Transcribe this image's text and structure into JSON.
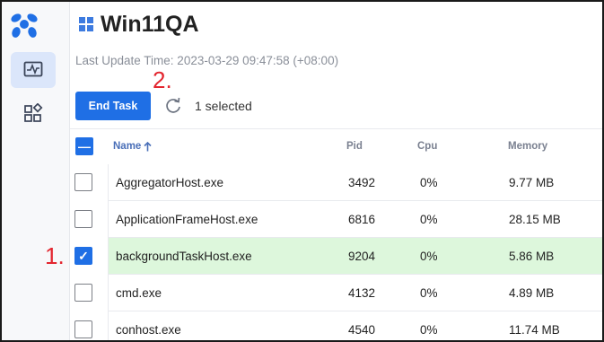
{
  "header": {
    "title": "Win11QA",
    "last_update": "Last Update Time: 2023-03-29 09:47:58 (+08:00)"
  },
  "toolbar": {
    "end_task_label": "End Task",
    "selected_text": "1 selected"
  },
  "annotations": {
    "one": "1.",
    "two": "2."
  },
  "table": {
    "columns": {
      "name": "Name",
      "pid": "Pid",
      "cpu": "Cpu",
      "memory": "Memory"
    },
    "sort": {
      "column": "Name",
      "direction": "ascending"
    },
    "rows": [
      {
        "name": "AggregatorHost.exe",
        "pid": "3492",
        "cpu": "0%",
        "memory": "9.77 MB",
        "checked": false
      },
      {
        "name": "ApplicationFrameHost.exe",
        "pid": "6816",
        "cpu": "0%",
        "memory": "28.15 MB",
        "checked": false
      },
      {
        "name": "backgroundTaskHost.exe",
        "pid": "9204",
        "cpu": "0%",
        "memory": "5.86 MB",
        "checked": true
      },
      {
        "name": "cmd.exe",
        "pid": "4132",
        "cpu": "0%",
        "memory": "4.89 MB",
        "checked": false
      },
      {
        "name": "conhost.exe",
        "pid": "4540",
        "cpu": "0%",
        "memory": "11.74 MB",
        "checked": false
      }
    ]
  },
  "colors": {
    "accent": "#1f6fe5",
    "selected_row": "#ddf7dc",
    "annotation": "#e3262f"
  },
  "icons": {
    "logo": "splashtop-logo-icon",
    "monitor": "activity-monitor-icon",
    "apps": "apps-grid-icon",
    "refresh": "refresh-icon",
    "sort": "arrow-up-icon",
    "windows": "windows-logo-icon"
  }
}
